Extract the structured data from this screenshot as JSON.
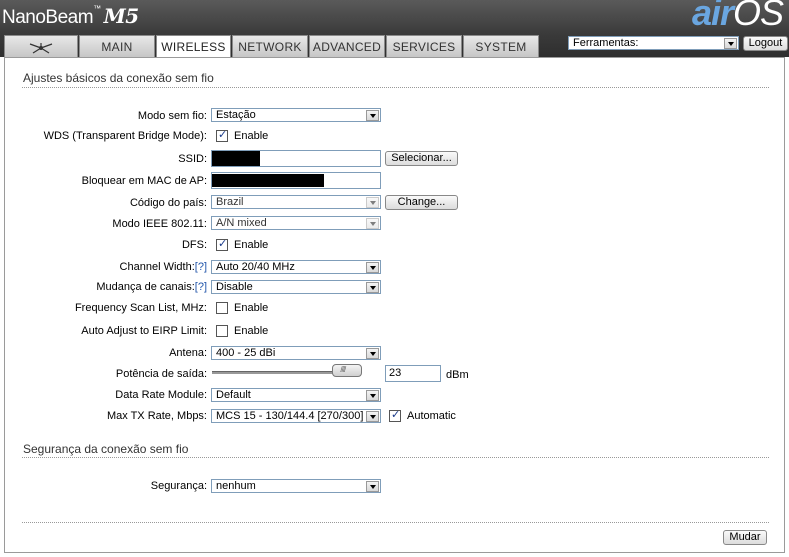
{
  "header": {
    "brand": "NanoBeam",
    "trademark": "™",
    "model": "M5",
    "logo_air": "air",
    "logo_os": "OS"
  },
  "tabs": [
    {
      "label": "",
      "icon": "ubiquiti-antenna-icon"
    },
    {
      "label": "MAIN"
    },
    {
      "label": "WIRELESS",
      "active": true
    },
    {
      "label": "NETWORK"
    },
    {
      "label": "ADVANCED"
    },
    {
      "label": "SERVICES"
    },
    {
      "label": "SYSTEM"
    }
  ],
  "tools": {
    "selected": "Ferramentas:"
  },
  "logout_label": "Logout",
  "basic": {
    "title": "Ajustes básicos da conexão sem fio",
    "wireless_mode": {
      "label": "Modo sem fio:",
      "value": "Estação"
    },
    "wds": {
      "label": "WDS (Transparent Bridge Mode):",
      "checked": true,
      "option": "Enable"
    },
    "ssid": {
      "label": "SSID:",
      "button": "Selecionar..."
    },
    "lock_ap": {
      "label": "Bloquear em MAC de AP:"
    },
    "country": {
      "label": "Código do país:",
      "value": "Brazil",
      "button": "Change..."
    },
    "ieee_mode": {
      "label": "Modo IEEE 802.11:",
      "value": "A/N mixed"
    },
    "dfs": {
      "label": "DFS:",
      "checked": true,
      "option": "Enable"
    },
    "channel_width": {
      "label": "Channel Width:",
      "help": "[?]",
      "value": "Auto 20/40 MHz"
    },
    "channel_shift": {
      "label": "Mudança de canais:",
      "help": "[?]",
      "value": "Disable"
    },
    "freq_scan": {
      "label": "Frequency Scan List, MHz:",
      "checked": false,
      "option": "Enable"
    },
    "auto_eirp": {
      "label": "Auto Adjust to EIRP Limit:",
      "checked": false,
      "option": "Enable"
    },
    "antenna": {
      "label": "Antena:",
      "value": "400 - 25 dBi"
    },
    "output_power": {
      "label": "Potência de saída:",
      "value": "23",
      "unit": "dBm",
      "slider_fraction": 0.86
    },
    "data_rate_module": {
      "label": "Data Rate Module:",
      "value": "Default"
    },
    "max_tx_rate": {
      "label": "Max TX Rate, Mbps:",
      "value": "MCS 15 - 130/144.4 [270/300]",
      "auto_checked": true,
      "auto_label": "Automatic"
    }
  },
  "security": {
    "title": "Segurança da conexão sem fio",
    "security": {
      "label": "Segurança:",
      "value": "nenhum"
    }
  },
  "change_button": "Mudar"
}
